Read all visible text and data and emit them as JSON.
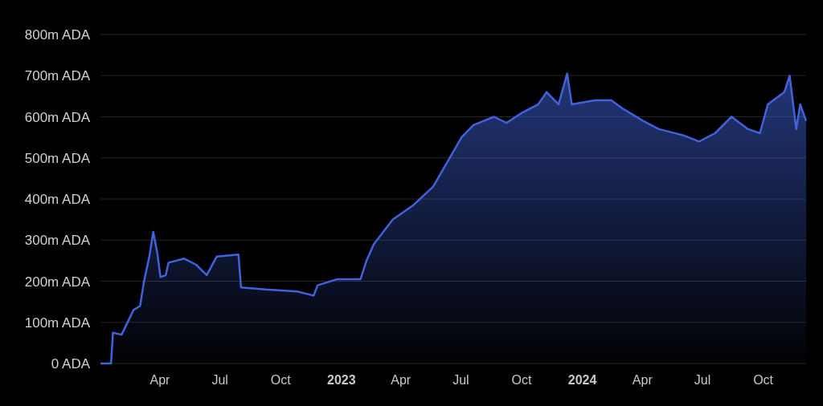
{
  "chart_data": {
    "type": "area",
    "grid": true,
    "x": [
      "2022-01-01",
      "2022-01-17",
      "2022-01-20",
      "2022-02-02",
      "2022-02-20",
      "2022-03-02",
      "2022-03-08",
      "2022-03-16",
      "2022-03-22",
      "2022-03-28",
      "2022-04-02",
      "2022-04-10",
      "2022-04-14",
      "2022-05-08",
      "2022-05-26",
      "2022-06-11",
      "2022-06-26",
      "2022-07-29",
      "2022-08-02",
      "2022-09-08",
      "2022-10-26",
      "2022-11-20",
      "2022-11-26",
      "2022-12-26",
      "2023-01-30",
      "2023-02-08",
      "2023-02-19",
      "2023-03-20",
      "2023-04-20",
      "2023-05-20",
      "2023-06-14",
      "2023-07-02",
      "2023-07-20",
      "2023-08-20",
      "2023-09-08",
      "2023-10-02",
      "2023-10-26",
      "2023-11-08",
      "2023-11-26",
      "2023-12-09",
      "2023-12-16",
      "2024-01-20",
      "2024-02-14",
      "2024-03-02",
      "2024-04-02",
      "2024-04-26",
      "2024-06-02",
      "2024-06-26",
      "2024-07-20",
      "2024-08-14",
      "2024-09-08",
      "2024-09-26",
      "2024-10-08",
      "2024-11-02",
      "2024-11-10",
      "2024-11-20",
      "2024-11-26",
      "2024-12-05"
    ],
    "series": [
      {
        "color": "#4062dc",
        "values": [
          0,
          0,
          75,
          70,
          130,
          140,
          200,
          260,
          320,
          270,
          210,
          215,
          245,
          255,
          240,
          215,
          260,
          265,
          185,
          180,
          175,
          165,
          190,
          205,
          205,
          250,
          290,
          350,
          385,
          430,
          500,
          550,
          580,
          600,
          585,
          610,
          630,
          660,
          630,
          705,
          630,
          640,
          640,
          620,
          590,
          570,
          555,
          540,
          560,
          600,
          570,
          560,
          630,
          660,
          700,
          570,
          630,
          590
        ]
      }
    ],
    "xlim": [
      "2022-01-01",
      "2024-12-05"
    ],
    "ylim": [
      0,
      800
    ],
    "xticks": [
      {
        "value": "2022-04-01",
        "label": "Apr"
      },
      {
        "value": "2022-07-01",
        "label": "Jul"
      },
      {
        "value": "2022-10-01",
        "label": "Oct"
      },
      {
        "value": "2023-01-01",
        "label": "**2023**"
      },
      {
        "value": "2023-04-01",
        "label": "Apr"
      },
      {
        "value": "2023-07-01",
        "label": "Jul"
      },
      {
        "value": "2023-10-01",
        "label": "Oct"
      },
      {
        "value": "2024-01-01",
        "label": "**2024**"
      },
      {
        "value": "2024-04-01",
        "label": "Apr"
      },
      {
        "value": "2024-07-01",
        "label": "Jul"
      },
      {
        "value": "2024-10-01",
        "label": "Oct"
      }
    ],
    "yticks": [
      {
        "value": 0,
        "label": "0 ADA"
      },
      {
        "value": 100,
        "label": "100m ADA"
      },
      {
        "value": 200,
        "label": "200m ADA"
      },
      {
        "value": 300,
        "label": "300m ADA"
      },
      {
        "value": 400,
        "label": "400m ADA"
      },
      {
        "value": 500,
        "label": "500m ADA"
      },
      {
        "value": 600,
        "label": "600m ADA"
      },
      {
        "value": 700,
        "label": "700m ADA"
      },
      {
        "value": 800,
        "label": "800m ADA"
      }
    ]
  }
}
